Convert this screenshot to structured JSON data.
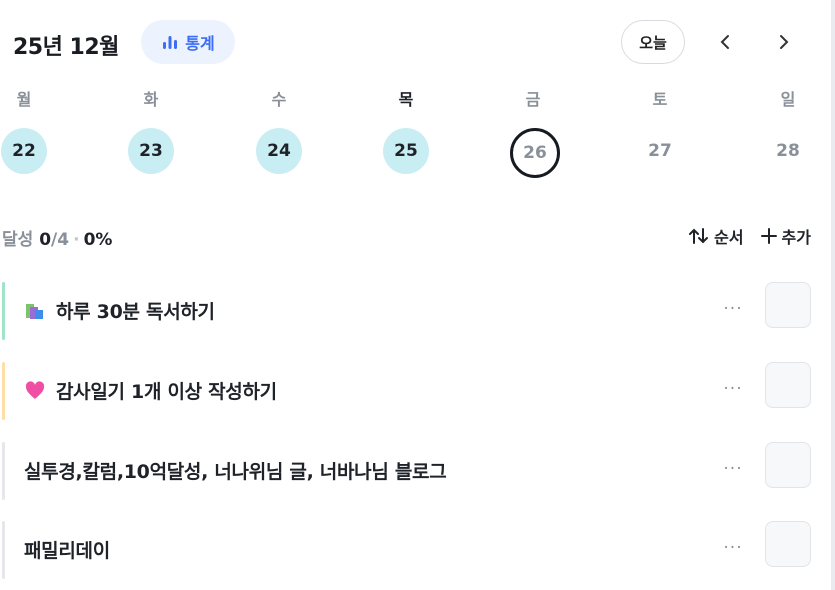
{
  "header": {
    "month": "25년 12월",
    "stats_label": "통계",
    "today_label": "오늘",
    "prev_label": "‹",
    "next_label": "›"
  },
  "weekdays": [
    "월",
    "화",
    "수",
    "목",
    "금",
    "토",
    "일"
  ],
  "dates": [
    "22",
    "23",
    "24",
    "25",
    "26",
    "27",
    "28"
  ],
  "progress": {
    "label": "달성",
    "done": "0",
    "total": "/4",
    "percent": "0%"
  },
  "actions": {
    "sort": "순서",
    "add": "추가"
  },
  "tasks": [
    {
      "title": "하루 30분 독서하기",
      "icon": "books-icon",
      "bar": "#9fe3c8"
    },
    {
      "title": "감사일기 1개 이상 작성하기",
      "icon": "heart-icon",
      "bar": "#ffdfa8"
    },
    {
      "title": "실투경,칼럼,10억달성, 너나위님 글, 너바나님 블로그",
      "icon": "",
      "bar": "#e5e7eb"
    },
    {
      "title": "패밀리데이",
      "icon": "",
      "bar": "#e5e7eb"
    }
  ],
  "more_label": "···"
}
